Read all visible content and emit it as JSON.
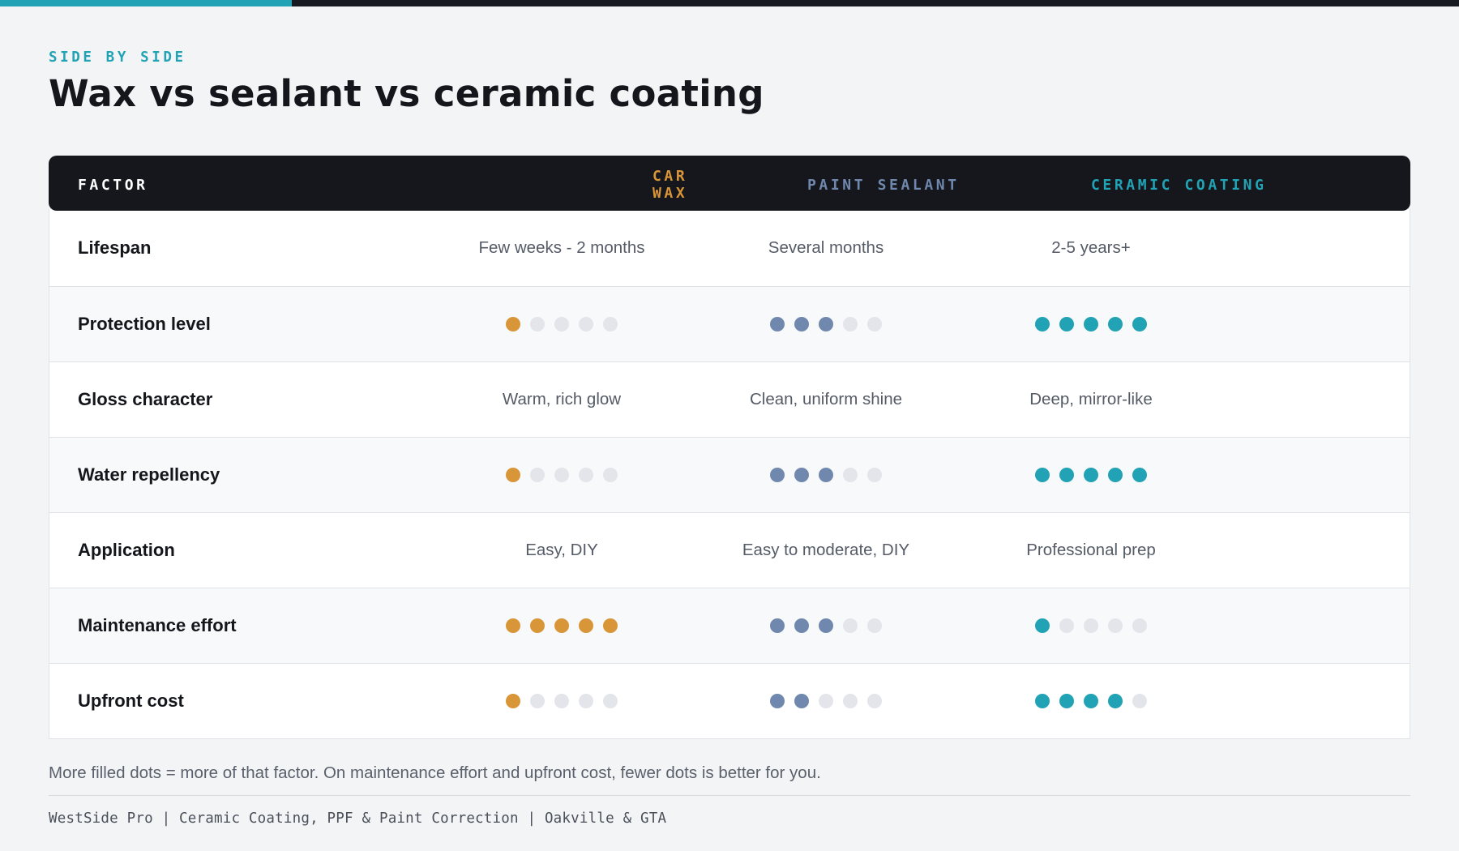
{
  "header": {
    "progress_fraction": 0.2,
    "progress_color": "#21a3b5",
    "eyebrow": "SIDE BY SIDE",
    "title": "Wax vs sealant vs ceramic coating"
  },
  "table": {
    "factor_header": "FACTOR",
    "columns": [
      {
        "key": "wax",
        "label": "CAR WAX",
        "color": "#d99638"
      },
      {
        "key": "sealant",
        "label": "PAINT SEALANT",
        "color": "#7088ae"
      },
      {
        "key": "ceramic",
        "label": "CERAMIC COATING",
        "color": "#21a3b5"
      }
    ],
    "rows": [
      {
        "factor": "Lifespan",
        "kind": "text",
        "wax": "Few weeks - 2 months",
        "sealant": "Several months",
        "ceramic": "2-5 years+"
      },
      {
        "factor": "Protection level",
        "kind": "dots",
        "wax": 1,
        "sealant": 3,
        "ceramic": 5
      },
      {
        "factor": "Gloss character",
        "kind": "text",
        "wax": "Warm, rich glow",
        "sealant": "Clean, uniform shine",
        "ceramic": "Deep, mirror-like"
      },
      {
        "factor": "Water repellency",
        "kind": "dots",
        "wax": 1,
        "sealant": 3,
        "ceramic": 5
      },
      {
        "factor": "Application",
        "kind": "text",
        "wax": "Easy, DIY",
        "sealant": "Easy to moderate, DIY",
        "ceramic": "Professional prep"
      },
      {
        "factor": "Maintenance effort",
        "kind": "dots",
        "wax": 5,
        "sealant": 3,
        "ceramic": 1
      },
      {
        "factor": "Upfront cost",
        "kind": "dots",
        "wax": 1,
        "sealant": 2,
        "ceramic": 4
      }
    ],
    "dot_max": 5,
    "empty_dot_color": "#e3e5ea"
  },
  "footnote": "More filled dots = more of that factor. On maintenance effort and upfront cost, fewer dots is better for you.",
  "footer": "WestSide Pro | Ceramic Coating, PPF & Paint Correction | Oakville & GTA"
}
